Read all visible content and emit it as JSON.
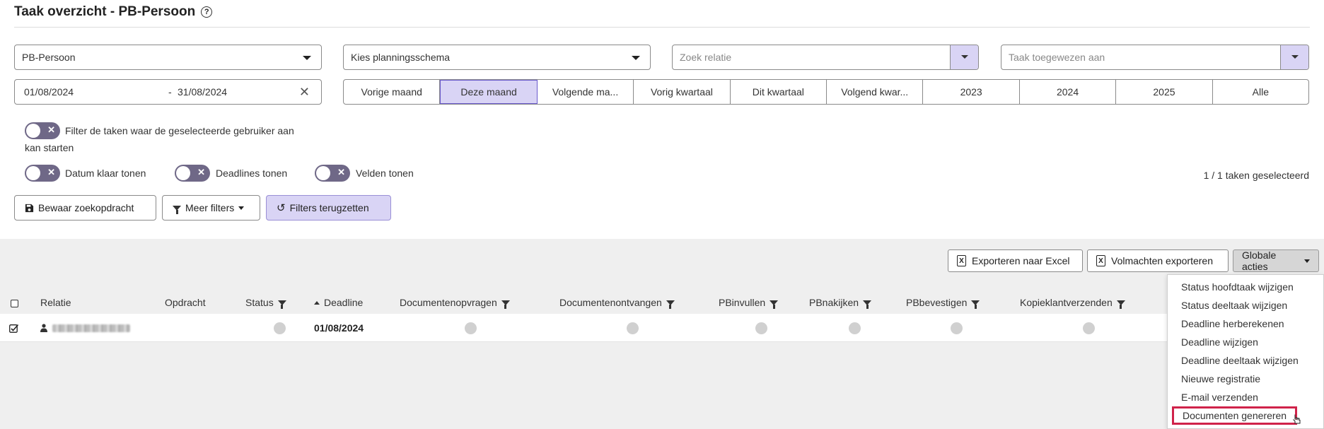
{
  "page": {
    "title": "Taak overzicht - PB-Persoon"
  },
  "filters": {
    "task_type": "PB-Persoon",
    "planning_schema_placeholder": "Kies planningsschema",
    "relation_placeholder": "Zoek relatie",
    "assigned_placeholder": "Taak toegewezen aan",
    "date_start": "01/08/2024",
    "date_separator": "-",
    "date_end": "31/08/2024",
    "periods": [
      "Vorige maand",
      "Deze maand",
      "Volgende ma...",
      "Vorig kwartaal",
      "Dit kwartaal",
      "Volgend kwar...",
      "2023",
      "2024",
      "2025",
      "Alle"
    ],
    "active_period": "Deze maand",
    "toggle_start_label_line1": "Filter de taken waar de geselecteerde gebruiker aan",
    "toggle_start_label_line2": "kan starten",
    "toggle_datum_label": "Datum klaar tonen",
    "toggle_deadlines_label": "Deadlines tonen",
    "toggle_velden_label": "Velden tonen",
    "selection_count": "1 / 1 taken geselecteerd"
  },
  "actions": {
    "save_search": "Bewaar zoekopdracht",
    "more_filters": "Meer filters",
    "reset_filters": "Filters terugzetten",
    "export_excel": "Exporteren naar Excel",
    "export_volmachten": "Volmachten exporteren",
    "global_actions": "Globale acties"
  },
  "table": {
    "columns": [
      "Relatie",
      "Opdracht",
      "Status",
      "Deadline",
      "Documentenopvragen",
      "Documentenontvangen",
      "PBinvullen",
      "PBnakijken",
      "PBbevestigen",
      "Kopieklantverzenden"
    ],
    "rows": [
      {
        "deadline": "01/08/2024"
      }
    ]
  },
  "global_menu": {
    "items": [
      "Status hoofdtaak wijzigen",
      "Status deeltaak wijzigen",
      "Deadline herberekenen",
      "Deadline wijzigen",
      "Deadline deeltaak wijzigen",
      "Nieuwe registratie",
      "E-mail verzenden",
      "Documenten genereren"
    ],
    "highlighted": "Documenten genereren"
  },
  "colors": {
    "accent_purple": "#d9d4f5",
    "toggle_off": "#6f6887",
    "highlight_red": "#d0234a"
  }
}
